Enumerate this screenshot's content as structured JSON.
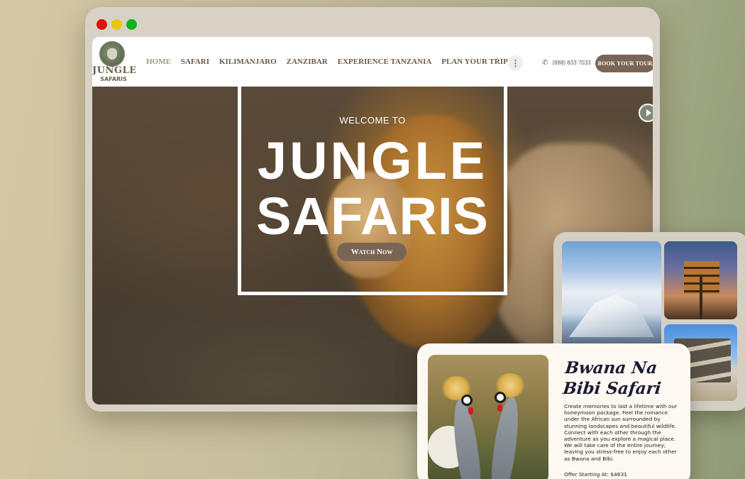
{
  "window": {
    "controls": [
      "close",
      "minimize",
      "maximize"
    ],
    "control_colors": {
      "close": "#e0110f",
      "minimize": "#e6c90a",
      "maximize": "#12b21b"
    }
  },
  "header": {
    "logo": {
      "line1": "JUNGLE",
      "line2": "SAFARIS",
      "icon": "elephant-lion-badge"
    },
    "nav": [
      {
        "label": "HOME",
        "active": true
      },
      {
        "label": "SAFARI",
        "active": false
      },
      {
        "label": "KILIMANJARO",
        "active": false
      },
      {
        "label": "ZANZIBAR",
        "active": false
      },
      {
        "label": "EXPERIENCE TANZANIA",
        "active": false
      },
      {
        "label": "PLAN YOUR TRIP",
        "active": false
      }
    ],
    "more_icon": "vertical-dots-icon",
    "phone": "(888) 833 7033",
    "book_button": "BOOK YOUR TOUR",
    "accent_color": "#7a6555",
    "active_color": "#8fa186"
  },
  "hero": {
    "welcome": "WELCOME TO",
    "title_line1": "JUNGLE",
    "title_line2": "SAFARIS",
    "cta": "Watch Now",
    "slider_icon": "play-icon"
  },
  "gallery": {
    "images": [
      "kilimanjaro-peak",
      "summit-signpost",
      "kibo-signpost"
    ]
  },
  "package": {
    "title_line1": "Bwana Na",
    "title_line2": "Bibi Safari",
    "description": "Create memories to last a lifetime with our honeymoon package. Feel the romance under the African sun surrounded by stunning landscapes and beautiful wildlife. Connect with each other through the adventure as you explore a magical place. We will take care of the entire journey; leaving you stress-free to enjoy each other as Bwana and Bibi.",
    "offer": "Offer Starting  At: $4631",
    "image": "crowned-cranes"
  }
}
